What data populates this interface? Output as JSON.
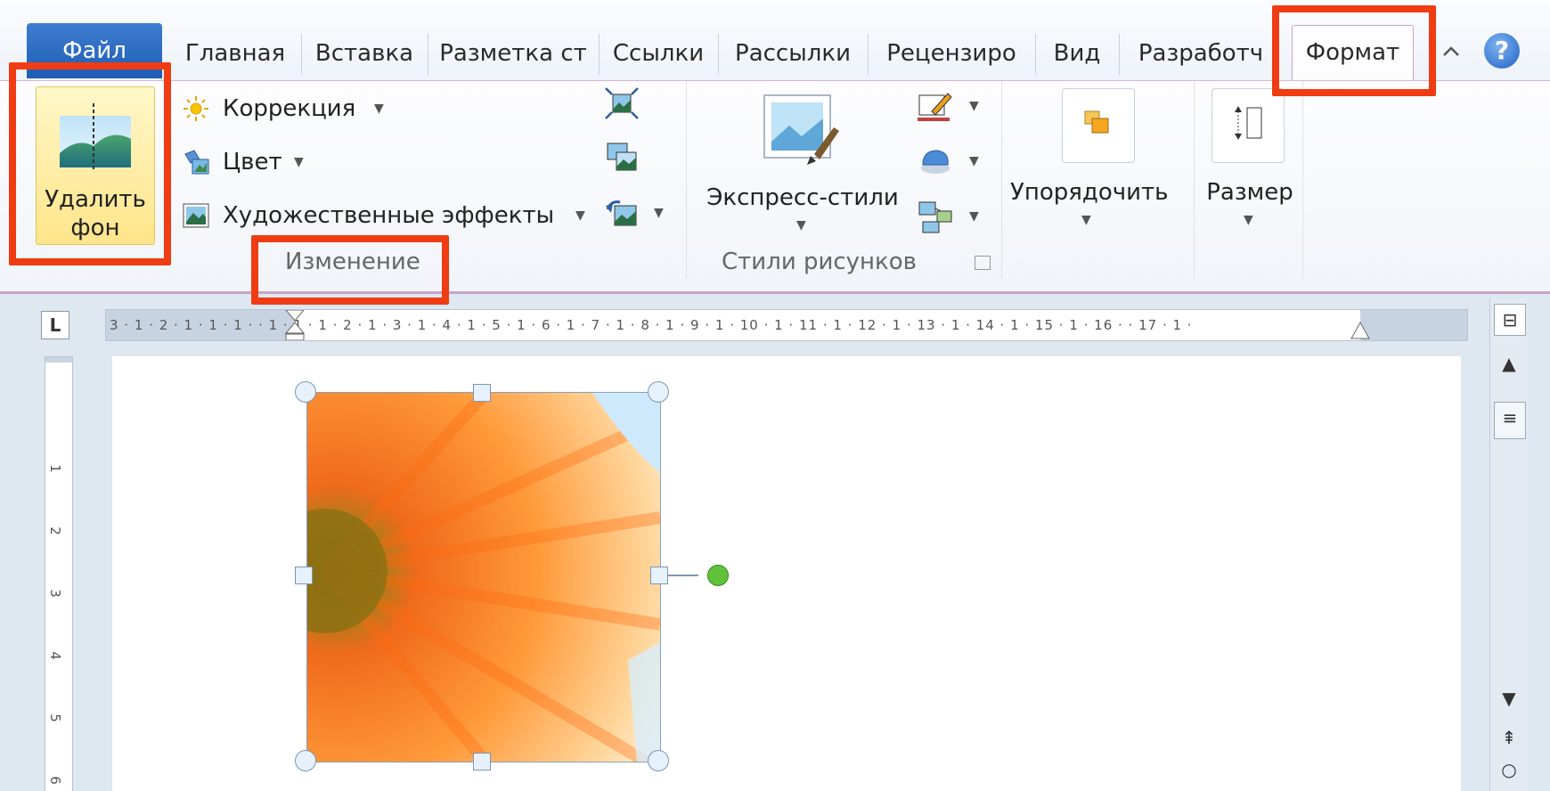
{
  "tabs": [
    {
      "label": "Файл",
      "active": false
    },
    {
      "label": "Главная"
    },
    {
      "label": "Вставка"
    },
    {
      "label": "Разметка ст"
    },
    {
      "label": "Ссылки"
    },
    {
      "label": "Рассылки"
    },
    {
      "label": "Рецензиро"
    },
    {
      "label": "Вид"
    },
    {
      "label": "Разработч"
    },
    {
      "label": "Формат",
      "active": true
    }
  ],
  "ribbon": {
    "remove_bg": {
      "label_line1": "Удалить",
      "label_line2": "фон"
    },
    "adjust": {
      "correction": "Коррекция",
      "color": "Цвет",
      "artistic_effects": "Художественные эффекты",
      "group_label": "Изменение"
    },
    "styles": {
      "express_styles": "Экспресс-стили",
      "group_label": "Стили рисунков"
    },
    "arrange": {
      "label": "Упорядочить"
    },
    "size": {
      "label": "Размер"
    }
  },
  "ruler": {
    "corner_glyph": "L",
    "horizontal_ticks": "3 · 1 · 2 · 1 · 1 · 1 ·   · 1 · 1 · 1 · 2 · 1 · 3 · 1 · 4 · 1 · 5 · 1 · 6 · 1 · 7 · 1 · 8 · 1 · 9 · 1 · 10 · 1 · 11 · 1 · 12 · 1 · 13 · 1 · 14 · 1 · 15 · 1 · 16 ·   · 17 · 1 ·",
    "vertical_ticks": [
      "1",
      "2",
      "3",
      "4",
      "5",
      "6"
    ]
  },
  "colors": {
    "highlight": "#f03c12",
    "file_tab": "#2a6ac6",
    "format_tab_border": "#c9a3c9",
    "remove_bg_fill": "#ffe58a"
  },
  "icons": {
    "collapse": "collapse-ribbon-icon",
    "help": "help-icon"
  },
  "help_glyph": "?"
}
